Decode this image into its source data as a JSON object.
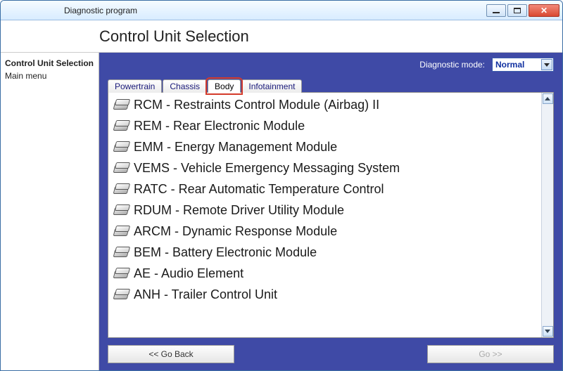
{
  "window": {
    "title": "Diagnostic program"
  },
  "heading": "Control Unit Selection",
  "sidebar": {
    "items": [
      {
        "label": "Control Unit Selection",
        "bold": true
      },
      {
        "label": "Main menu",
        "bold": false
      }
    ]
  },
  "mode": {
    "label": "Diagnostic mode:",
    "value": "Normal"
  },
  "tabs": [
    {
      "label": "Powertrain",
      "active": false
    },
    {
      "label": "Chassis",
      "active": false
    },
    {
      "label": "Body",
      "active": true
    },
    {
      "label": "Infotainment",
      "active": false
    }
  ],
  "modules": [
    "RCM - Restraints Control Module (Airbag) II",
    "REM - Rear Electronic Module",
    "EMM - Energy Management Module",
    "VEMS - Vehicle Emergency Messaging System",
    "RATC - Rear Automatic Temperature Control",
    "RDUM - Remote Driver Utility Module",
    "ARCM - Dynamic Response Module",
    "BEM - Battery Electronic Module",
    "AE - Audio Element",
    "ANH - Trailer Control Unit"
  ],
  "footer": {
    "back": "<< Go Back",
    "go": "Go >>"
  }
}
